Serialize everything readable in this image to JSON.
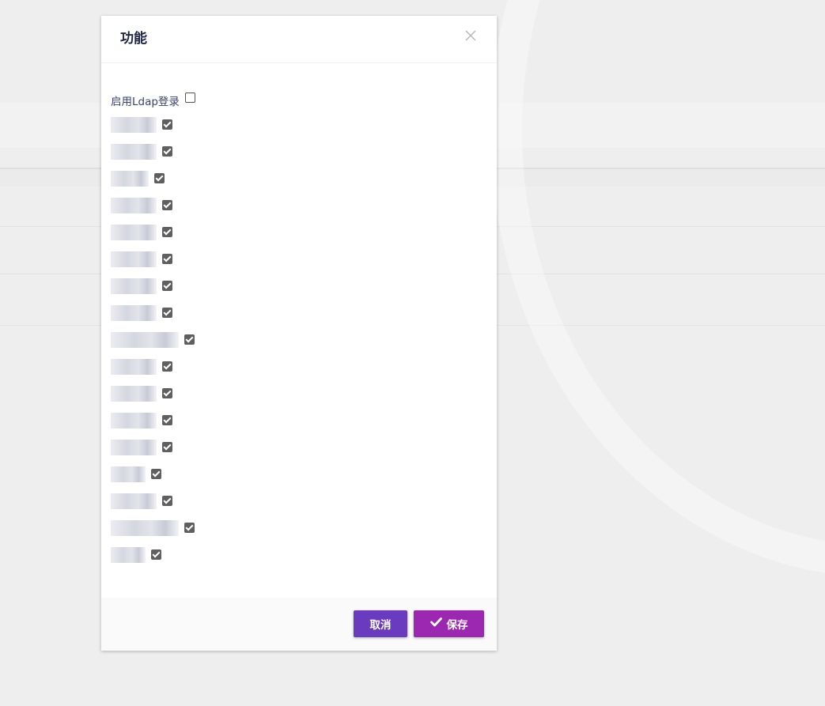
{
  "modal": {
    "title": "功能",
    "close_icon": "close-icon"
  },
  "features": [
    {
      "label": "启用Ldap登录",
      "checked": false,
      "redacted": false
    },
    {
      "label": "",
      "checked": true,
      "redacted": true
    },
    {
      "label": "",
      "checked": true,
      "redacted": true
    },
    {
      "label": "",
      "checked": true,
      "redacted": true
    },
    {
      "label": "",
      "checked": true,
      "redacted": true
    },
    {
      "label": "",
      "checked": true,
      "redacted": true
    },
    {
      "label": "",
      "checked": true,
      "redacted": true
    },
    {
      "label": "",
      "checked": true,
      "redacted": true
    },
    {
      "label": "",
      "checked": true,
      "redacted": true
    },
    {
      "label": "",
      "checked": true,
      "redacted": true
    },
    {
      "label": "",
      "checked": true,
      "redacted": true
    },
    {
      "label": "",
      "checked": true,
      "redacted": true
    },
    {
      "label": "",
      "checked": true,
      "redacted": true
    },
    {
      "label": "",
      "checked": true,
      "redacted": true
    },
    {
      "label": "",
      "checked": true,
      "redacted": true
    },
    {
      "label": "",
      "checked": true,
      "redacted": true
    },
    {
      "label": "",
      "checked": true,
      "redacted": true
    },
    {
      "label": "",
      "checked": true,
      "redacted": true
    }
  ],
  "footer": {
    "cancel_label": "取消",
    "save_label": "保存",
    "save_icon": "check-icon"
  },
  "colors": {
    "cancel_button": "#6a3bbf",
    "save_button": "#9c27b0",
    "title_text": "#1e2545",
    "label_text": "#3b4374"
  }
}
